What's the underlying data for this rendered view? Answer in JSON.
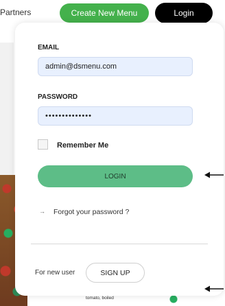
{
  "nav": {
    "partners_label": "Partners",
    "create_menu_label": "Create New Menu",
    "login_label": "Login"
  },
  "form": {
    "email_label": "EMAIL",
    "email_value": "admin@dsmenu.com",
    "password_label": "PASSWORD",
    "password_value": "••••••••••••••",
    "remember_label": "Remember Me",
    "remember_checked": false,
    "login_button": "LOGIN",
    "forgot_arrow": "→",
    "forgot_label": "Forgot your password ?",
    "new_user_label": "For new user",
    "signup_button": "SIGN UP"
  },
  "background": {
    "card_description": "avocado, bacon, cheddar cheese, tomato, boiled"
  },
  "colors": {
    "create_button": "#44b14c",
    "login_button": "#5dbd87",
    "input_background": "#e8f0fe",
    "top_login_button": "#000000"
  }
}
